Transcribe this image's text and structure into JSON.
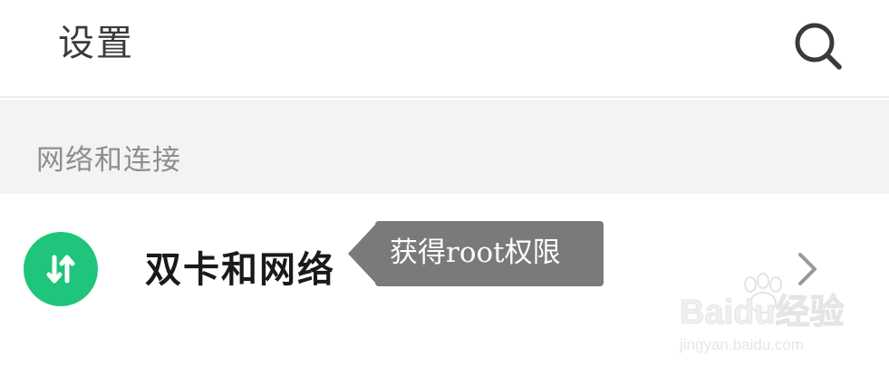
{
  "header": {
    "title": "设置",
    "search_icon": "search-icon"
  },
  "section": {
    "title": "网络和连接"
  },
  "items": [
    {
      "label": "双卡和网络",
      "icon": "data-transfer-arrows-icon",
      "icon_color": "#1ec57a",
      "chevron_icon": "chevron-right-icon"
    }
  ],
  "annotation": {
    "text": "获得root权限"
  },
  "watermark": {
    "brand": "Baidu经验",
    "url": "jingyan.baidu.com"
  },
  "colors": {
    "background": "#ffffff",
    "section_background": "#f3f3f5",
    "accent_green": "#1ec57a",
    "callout": "#7a7a7a"
  }
}
